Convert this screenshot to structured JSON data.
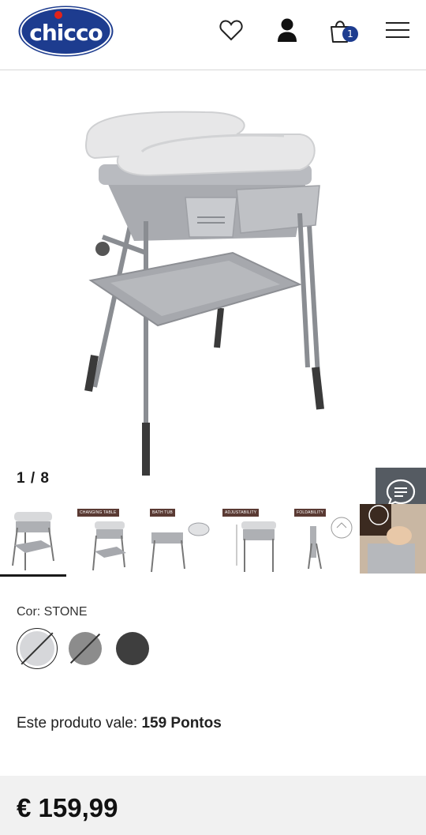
{
  "header": {
    "logo_text": "chicco",
    "cart_count": "1",
    "icons": [
      "heart-icon",
      "user-icon",
      "shopping-bag-icon",
      "hamburger-menu-icon"
    ]
  },
  "gallery": {
    "counter": "1 / 8",
    "thumbnails": [
      {
        "tag": ""
      },
      {
        "tag": "CHANGING TABLE"
      },
      {
        "tag": "BATH TUB"
      },
      {
        "tag": "ADJUSTABILITY"
      },
      {
        "tag": "FOLDABILITY"
      },
      {
        "tag": ""
      }
    ]
  },
  "product": {
    "color_label": "Cor: STONE",
    "swatches": [
      {
        "name": "stone",
        "color": "#d6d7da",
        "selected": true
      },
      {
        "name": "grey",
        "color": "#8c8c8c",
        "selected": false
      },
      {
        "name": "dark",
        "color": "#3e3e3e",
        "selected": false
      }
    ],
    "points_prefix": "Este produto vale: ",
    "points_value": "159 Pontos",
    "price": "€ 159,99"
  },
  "colors": {
    "brand_blue": "#1d3c8f",
    "logo_red": "#e2231a",
    "chat_button": "#555b62",
    "price_bar": "#f1f1f1"
  }
}
